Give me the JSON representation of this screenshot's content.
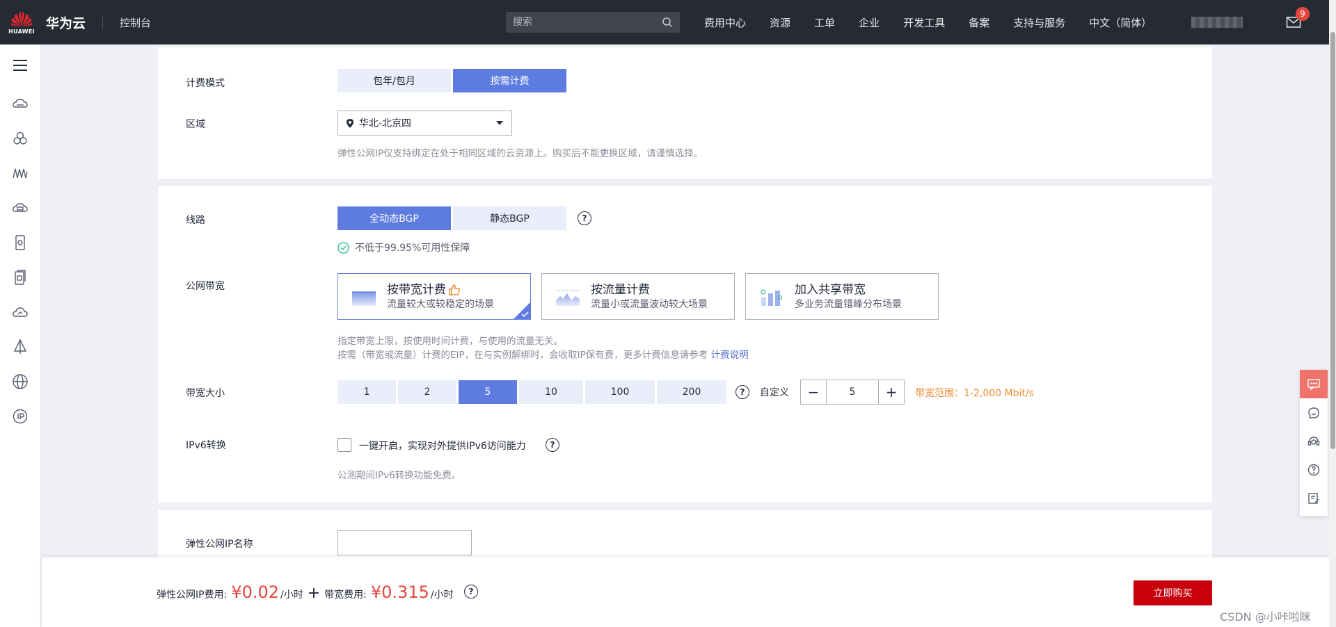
{
  "header": {
    "logo_text": "HUAWEI",
    "brand": "华为云",
    "console": "控制台",
    "search_placeholder": "搜索",
    "nav": [
      "费用中心",
      "资源",
      "工单",
      "企业",
      "开发工具",
      "备案",
      "支持与服务",
      "中文（简体）"
    ],
    "mail_badge": "9"
  },
  "sidebar": {
    "icons": [
      "menu-icon",
      "cloud-server-icon",
      "cluster-icon",
      "network-icon",
      "cloud-disk-icon",
      "storage-icon",
      "backup-icon",
      "cloud-icon",
      "sail-icon",
      "globe-icon",
      "ip-icon"
    ]
  },
  "billing": {
    "label": "计费模式",
    "options": [
      "包年/包月",
      "按需计费"
    ],
    "selected": "按需计费"
  },
  "region": {
    "label": "区域",
    "value": "华北-北京四",
    "hint": "弹性公网IP仅支持绑定在处于相同区域的云资源上。购买后不能更换区域，请谨慎选择。"
  },
  "line": {
    "label": "线路",
    "options": [
      "全动态BGP",
      "静态BGP"
    ],
    "selected": "全动态BGP",
    "guarantee": "不低于99.95%可用性保障"
  },
  "bandwidth_type": {
    "label": "公网带宽",
    "cards": [
      {
        "title": "按带宽计费",
        "subtitle": "流量较大或较稳定的场景"
      },
      {
        "title": "按流量计费",
        "subtitle": "流量小或流量波动较大场景"
      },
      {
        "title": "加入共享带宽",
        "subtitle": "多业务流量错峰分布场景"
      }
    ],
    "hint1": "指定带宽上限，按使用时间计费，与使用的流量无关。",
    "hint2": "按需（带宽或流量）计费的EIP，在与实例解绑时，会收取IP保有费，更多计费信息请参考",
    "hint_link": "计费说明"
  },
  "bandwidth_size": {
    "label": "带宽大小",
    "options": [
      "1",
      "2",
      "5",
      "10",
      "100",
      "200"
    ],
    "selected": "5",
    "custom_label": "自定义",
    "custom_value": "5",
    "range": "带宽范围：1-2,000 Mbit/s"
  },
  "ipv6": {
    "label": "IPv6转换",
    "checkbox_text": "一键开启，实现对外提供IPv6访问能力",
    "hint": "公测期间IPv6转换功能免费。"
  },
  "eip_name": {
    "label": "弹性公网IP名称",
    "value": ""
  },
  "footer": {
    "ip_fee_label": "弹性公网IP费用:",
    "ip_fee": "¥0.02",
    "ip_fee_unit": "/小时",
    "plus": "+",
    "bw_fee_label": "带宽费用:",
    "bw_fee": "¥0.315",
    "bw_fee_unit": "/小时",
    "buy_label": "立即购买"
  },
  "watermark": "CSDN @小咔啦眯",
  "colors": {
    "accent": "#5e7ce0",
    "buy": "#c7000b",
    "price": "#e6453c",
    "range": "#ed8b2e"
  }
}
